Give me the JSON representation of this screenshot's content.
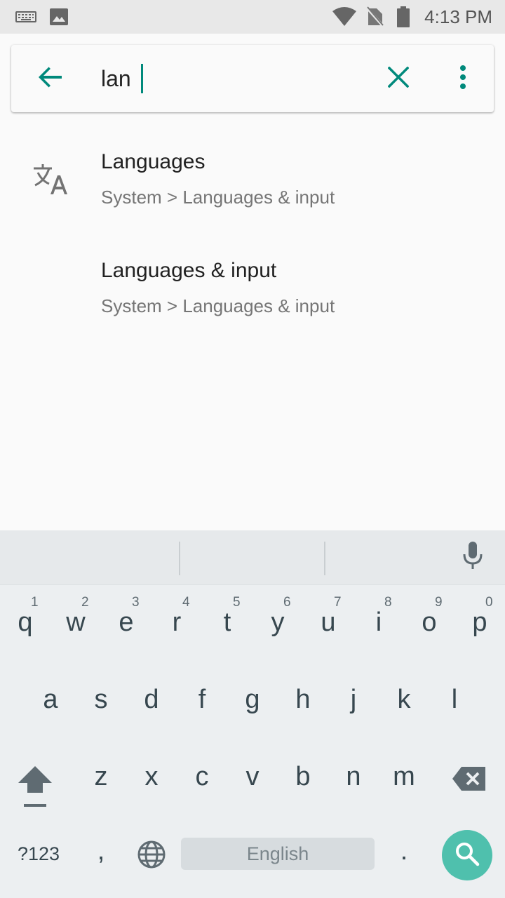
{
  "status_bar": {
    "time": "4:13 PM",
    "icons": [
      "keyboard-icon",
      "image-icon",
      "wifi-icon",
      "no-sim-icon",
      "battery-icon"
    ]
  },
  "search": {
    "query": "lan",
    "back_icon": "arrow-back-icon",
    "clear_icon": "close-icon",
    "menu_icon": "more-vert-icon"
  },
  "results": [
    {
      "title": "Languages",
      "breadcrumb": "System > Languages & input",
      "icon": "translate-icon"
    },
    {
      "title": "Languages & input",
      "breadcrumb": "System > Languages & input"
    }
  ],
  "keyboard": {
    "row1": [
      {
        "key": "q",
        "hint": "1"
      },
      {
        "key": "w",
        "hint": "2"
      },
      {
        "key": "e",
        "hint": "3"
      },
      {
        "key": "r",
        "hint": "4"
      },
      {
        "key": "t",
        "hint": "5"
      },
      {
        "key": "y",
        "hint": "6"
      },
      {
        "key": "u",
        "hint": "7"
      },
      {
        "key": "i",
        "hint": "8"
      },
      {
        "key": "o",
        "hint": "9"
      },
      {
        "key": "p",
        "hint": "0"
      }
    ],
    "row2": [
      "a",
      "s",
      "d",
      "f",
      "g",
      "h",
      "j",
      "k",
      "l"
    ],
    "row3": [
      "z",
      "x",
      "c",
      "v",
      "b",
      "n",
      "m"
    ],
    "symbols_label": "?123",
    "comma": ",",
    "period": ".",
    "space_label": "English",
    "accent_color": "#4fc0ad"
  },
  "colors": {
    "accent": "#00897b",
    "status_bar": "#e8e8e8",
    "keyboard_bg": "#eceff1"
  }
}
